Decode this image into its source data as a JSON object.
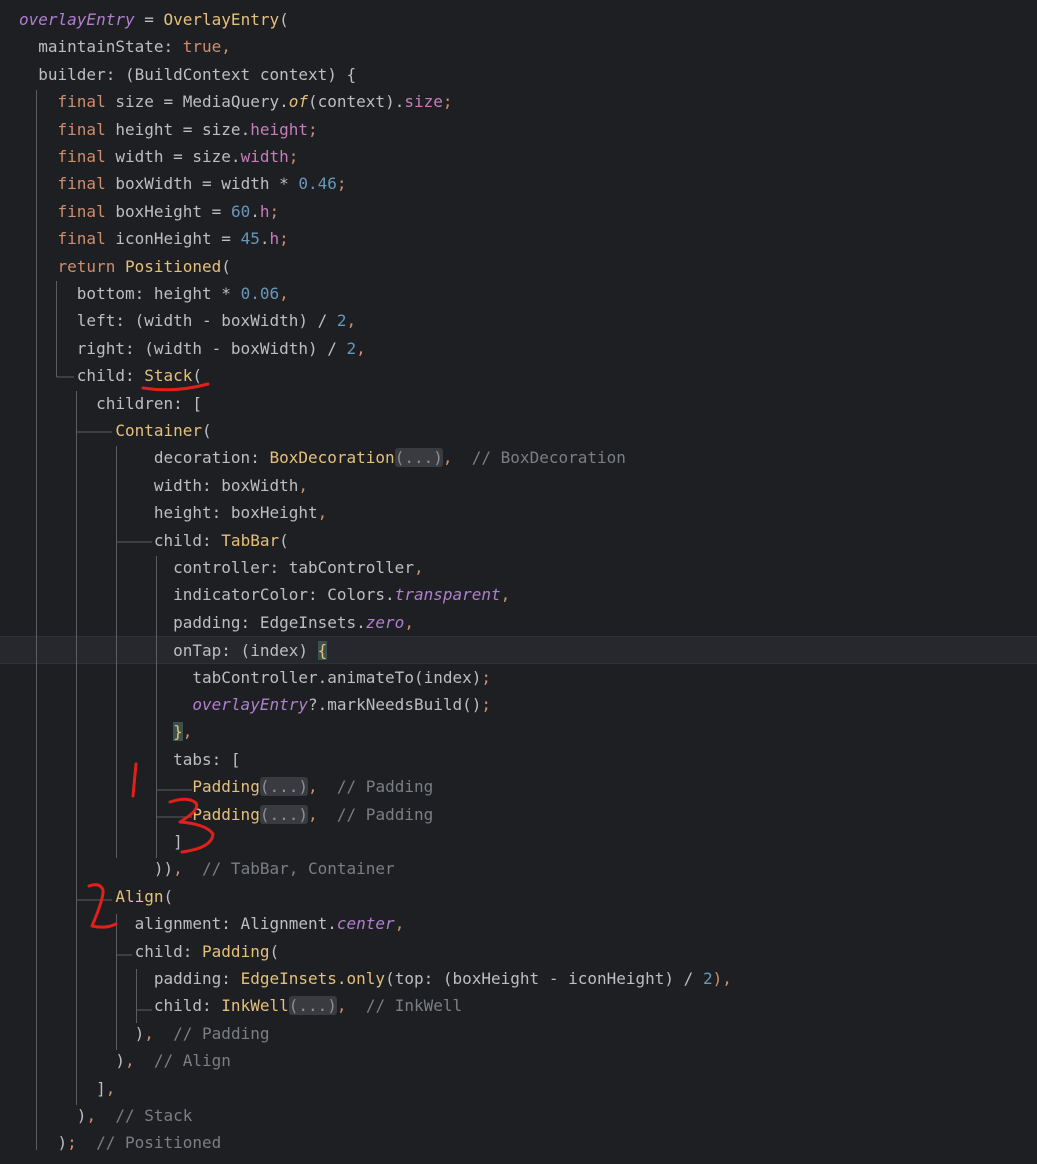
{
  "code_lines": [
    [
      {
        "t": "overlayEntry",
        "c": "tok-ital"
      },
      {
        "t": " = ",
        "c": "tok-plain"
      },
      {
        "t": "OverlayEntry",
        "c": "tok-cls"
      },
      {
        "t": "(",
        "c": "tok-plain"
      }
    ],
    [
      {
        "t": "  maintainState: ",
        "c": "tok-plain"
      },
      {
        "t": "true",
        "c": "tok-kw"
      },
      {
        "t": ",",
        "c": "tok-kw"
      }
    ],
    [
      {
        "t": "  builder: (BuildContext context) {",
        "c": "tok-plain"
      }
    ],
    [
      {
        "t": "    ",
        "c": "tok-plain"
      },
      {
        "t": "final",
        "c": "tok-kw"
      },
      {
        "t": " size = MediaQuery.",
        "c": "tok-plain"
      },
      {
        "t": "of",
        "c": "tok-fn"
      },
      {
        "t": "(context).",
        "c": "tok-plain"
      },
      {
        "t": "size",
        "c": "tok-prop"
      },
      {
        "t": ";",
        "c": "tok-kw"
      }
    ],
    [
      {
        "t": "    ",
        "c": "tok-plain"
      },
      {
        "t": "final",
        "c": "tok-kw"
      },
      {
        "t": " height = size.",
        "c": "tok-plain"
      },
      {
        "t": "height",
        "c": "tok-prop"
      },
      {
        "t": ";",
        "c": "tok-kw"
      }
    ],
    [
      {
        "t": "    ",
        "c": "tok-plain"
      },
      {
        "t": "final",
        "c": "tok-kw"
      },
      {
        "t": " width = size.",
        "c": "tok-plain"
      },
      {
        "t": "width",
        "c": "tok-prop"
      },
      {
        "t": ";",
        "c": "tok-kw"
      }
    ],
    [
      {
        "t": "    ",
        "c": "tok-plain"
      },
      {
        "t": "final",
        "c": "tok-kw"
      },
      {
        "t": " boxWidth = width * ",
        "c": "tok-plain"
      },
      {
        "t": "0.46",
        "c": "tok-num"
      },
      {
        "t": ";",
        "c": "tok-kw"
      }
    ],
    [
      {
        "t": "    ",
        "c": "tok-plain"
      },
      {
        "t": "final",
        "c": "tok-kw"
      },
      {
        "t": " boxHeight = ",
        "c": "tok-plain"
      },
      {
        "t": "60",
        "c": "tok-num"
      },
      {
        "t": ".",
        "c": "tok-plain"
      },
      {
        "t": "h",
        "c": "tok-prop"
      },
      {
        "t": ";",
        "c": "tok-kw"
      }
    ],
    [
      {
        "t": "    ",
        "c": "tok-plain"
      },
      {
        "t": "final",
        "c": "tok-kw"
      },
      {
        "t": " iconHeight = ",
        "c": "tok-plain"
      },
      {
        "t": "45",
        "c": "tok-num"
      },
      {
        "t": ".",
        "c": "tok-plain"
      },
      {
        "t": "h",
        "c": "tok-prop"
      },
      {
        "t": ";",
        "c": "tok-kw"
      }
    ],
    [
      {
        "t": "    ",
        "c": "tok-plain"
      },
      {
        "t": "return",
        "c": "tok-kw"
      },
      {
        "t": " ",
        "c": "tok-plain"
      },
      {
        "t": "Positioned",
        "c": "tok-cls"
      },
      {
        "t": "(",
        "c": "tok-plain"
      }
    ],
    [
      {
        "t": "      bottom: height * ",
        "c": "tok-plain"
      },
      {
        "t": "0.06",
        "c": "tok-num"
      },
      {
        "t": ",",
        "c": "tok-kw"
      }
    ],
    [
      {
        "t": "      left: (width - boxWidth) / ",
        "c": "tok-plain"
      },
      {
        "t": "2",
        "c": "tok-num"
      },
      {
        "t": ",",
        "c": "tok-kw"
      }
    ],
    [
      {
        "t": "      right: (width - boxWidth) / ",
        "c": "tok-plain"
      },
      {
        "t": "2",
        "c": "tok-num"
      },
      {
        "t": ",",
        "c": "tok-kw"
      }
    ],
    [
      {
        "t": "      child: ",
        "c": "tok-plain"
      },
      {
        "t": "Stack",
        "c": "tok-cls"
      },
      {
        "t": "(",
        "c": "tok-plain"
      }
    ],
    [
      {
        "t": "        children: [",
        "c": "tok-plain"
      }
    ],
    [
      {
        "t": "          ",
        "c": "tok-plain"
      },
      {
        "t": "Container",
        "c": "tok-cls"
      },
      {
        "t": "(",
        "c": "tok-plain"
      }
    ],
    [
      {
        "t": "              decoration: ",
        "c": "tok-plain"
      },
      {
        "t": "BoxDecoration",
        "c": "tok-cls"
      },
      {
        "t": "(...)",
        "c": "tok-fold"
      },
      {
        "t": ",",
        "c": "tok-kw"
      },
      {
        "t": "  // BoxDecoration",
        "c": "tok-cmt"
      }
    ],
    [
      {
        "t": "              width: boxWidth",
        "c": "tok-plain"
      },
      {
        "t": ",",
        "c": "tok-kw"
      }
    ],
    [
      {
        "t": "              height: boxHeight",
        "c": "tok-plain"
      },
      {
        "t": ",",
        "c": "tok-kw"
      }
    ],
    [
      {
        "t": "              child: ",
        "c": "tok-plain"
      },
      {
        "t": "TabBar",
        "c": "tok-cls"
      },
      {
        "t": "(",
        "c": "tok-plain"
      }
    ],
    [
      {
        "t": "                controller: tabController",
        "c": "tok-plain"
      },
      {
        "t": ",",
        "c": "tok-kw"
      }
    ],
    [
      {
        "t": "                indicatorColor: Colors.",
        "c": "tok-plain"
      },
      {
        "t": "transparent",
        "c": "tok-ital"
      },
      {
        "t": ",",
        "c": "tok-kw"
      }
    ],
    [
      {
        "t": "                padding: EdgeInsets.",
        "c": "tok-plain"
      },
      {
        "t": "zero",
        "c": "tok-ital"
      },
      {
        "t": ",",
        "c": "tok-kw"
      }
    ],
    [
      {
        "t": "                onTap: (index) ",
        "c": "tok-plain"
      },
      {
        "t": "{",
        "c": "brace-hl"
      }
    ],
    [
      {
        "t": "                  tabController.animateTo(index)",
        "c": "tok-plain"
      },
      {
        "t": ";",
        "c": "tok-kw"
      }
    ],
    [
      {
        "t": "                  ",
        "c": "tok-plain"
      },
      {
        "t": "overlayEntry",
        "c": "tok-ital"
      },
      {
        "t": "?.markNeedsBuild()",
        "c": "tok-plain"
      },
      {
        "t": ";",
        "c": "tok-kw"
      }
    ],
    [
      {
        "t": "                ",
        "c": "tok-plain"
      },
      {
        "t": "}",
        "c": "brace-hl"
      },
      {
        "t": ",",
        "c": "tok-kw"
      }
    ],
    [
      {
        "t": "                tabs: [",
        "c": "tok-plain"
      }
    ],
    [
      {
        "t": "                  ",
        "c": "tok-plain"
      },
      {
        "t": "Padding",
        "c": "tok-cls"
      },
      {
        "t": "(...)",
        "c": "tok-fold"
      },
      {
        "t": ",",
        "c": "tok-kw"
      },
      {
        "t": "  // Padding",
        "c": "tok-cmt"
      }
    ],
    [
      {
        "t": "                  ",
        "c": "tok-plain"
      },
      {
        "t": "Padding",
        "c": "tok-cls"
      },
      {
        "t": "(...)",
        "c": "tok-fold"
      },
      {
        "t": ",",
        "c": "tok-kw"
      },
      {
        "t": "  // Padding",
        "c": "tok-cmt"
      }
    ],
    [
      {
        "t": "                ]",
        "c": "tok-plain"
      }
    ],
    [
      {
        "t": "              ))",
        "c": "tok-plain"
      },
      {
        "t": ",",
        "c": "tok-kw"
      },
      {
        "t": "  // TabBar, Container",
        "c": "tok-cmt"
      }
    ],
    [
      {
        "t": "          ",
        "c": "tok-plain"
      },
      {
        "t": "Align",
        "c": "tok-cls"
      },
      {
        "t": "(",
        "c": "tok-plain"
      }
    ],
    [
      {
        "t": "            alignment: Alignment.",
        "c": "tok-plain"
      },
      {
        "t": "center",
        "c": "tok-ital"
      },
      {
        "t": ",",
        "c": "tok-kw"
      }
    ],
    [
      {
        "t": "            child: ",
        "c": "tok-plain"
      },
      {
        "t": "Padding",
        "c": "tok-cls"
      },
      {
        "t": "(",
        "c": "tok-plain"
      }
    ],
    [
      {
        "t": "              padding: ",
        "c": "tok-plain"
      },
      {
        "t": "EdgeInsets.only",
        "c": "tok-cls"
      },
      {
        "t": "(top: (boxHeight - iconHeight) / ",
        "c": "tok-plain"
      },
      {
        "t": "2",
        "c": "tok-num"
      },
      {
        "t": "),",
        "c": "tok-kw"
      }
    ],
    [
      {
        "t": "              child: ",
        "c": "tok-plain"
      },
      {
        "t": "InkWell",
        "c": "tok-cls"
      },
      {
        "t": "(...)",
        "c": "tok-fold"
      },
      {
        "t": ",",
        "c": "tok-kw"
      },
      {
        "t": "  // InkWell",
        "c": "tok-cmt"
      }
    ],
    [
      {
        "t": "            )",
        "c": "tok-plain"
      },
      {
        "t": ",",
        "c": "tok-kw"
      },
      {
        "t": "  // Padding",
        "c": "tok-cmt"
      }
    ],
    [
      {
        "t": "          )",
        "c": "tok-plain"
      },
      {
        "t": ",",
        "c": "tok-kw"
      },
      {
        "t": "  // Align",
        "c": "tok-cmt"
      }
    ],
    [
      {
        "t": "        ]",
        "c": "tok-plain"
      },
      {
        "t": ",",
        "c": "tok-kw"
      }
    ],
    [
      {
        "t": "      )",
        "c": "tok-plain"
      },
      {
        "t": ",",
        "c": "tok-kw"
      },
      {
        "t": "  // Stack",
        "c": "tok-cmt"
      }
    ],
    [
      {
        "t": "    )",
        "c": "tok-plain"
      },
      {
        "t": ";",
        "c": "tok-kw"
      },
      {
        "t": "  // Positioned",
        "c": "tok-cmt"
      }
    ]
  ],
  "caret_line_index": 23,
  "annotations": {
    "marks": [
      "1",
      "2",
      "3"
    ],
    "color": "#e0201a"
  }
}
